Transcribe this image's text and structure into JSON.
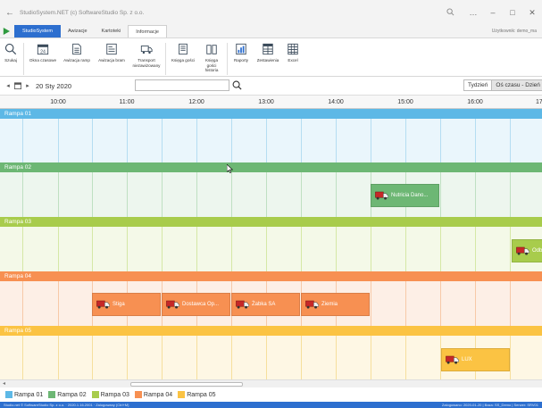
{
  "window": {
    "title": "StudioSystem.NET (c) SoftwareStudio Sp. z o.o.",
    "controls": [
      "…",
      "–",
      "□",
      "✕"
    ]
  },
  "ribbon_tabs": [
    {
      "label": "StudioSystem"
    },
    {
      "label": "Awizacje"
    },
    {
      "label": "Kartoteki"
    },
    {
      "label": "Informacje"
    }
  ],
  "user_label": "Użytkownik: demo_ma",
  "toolbar": [
    {
      "label": "Szukaj",
      "icon": "search-icon"
    },
    {
      "label": "Okna czasowe",
      "icon": "calendar-icon"
    },
    {
      "label": "Awizacja ramp",
      "icon": "document-icon"
    },
    {
      "label": "Awizacja bram",
      "icon": "gate-document-icon"
    },
    {
      "label": "Transport niezawizowany",
      "icon": "truck-icon"
    },
    {
      "label": "Księga gości",
      "icon": "book-icon"
    },
    {
      "label": "Księga gości historia",
      "icon": "book-open-icon"
    },
    {
      "label": "Raporty",
      "icon": "report-chart-icon"
    },
    {
      "label": "Zestawienia",
      "icon": "summary-table-icon"
    },
    {
      "label": "Excel",
      "icon": "excel-icon"
    }
  ],
  "datebar": {
    "date": "20 Sty 2020",
    "search_value": "",
    "view_week": "Tydzień",
    "view_axis": "Oś czasu - Dzień"
  },
  "times": [
    "10:00",
    "11:00",
    "12:00",
    "13:00",
    "14:00",
    "15:00",
    "16:00",
    "17"
  ],
  "ramps": [
    {
      "name": "Rampa 01",
      "color": "#5db8e6",
      "bg": "#eaf6fc",
      "line": "#b5ddf2"
    },
    {
      "name": "Rampa 02",
      "color": "#6db774",
      "bg": "#edf6ee",
      "line": "#bfe0c2"
    },
    {
      "name": "Rampa 03",
      "color": "#a8cc4c",
      "bg": "#f4f9e8",
      "line": "#d5e8a6"
    },
    {
      "name": "Rampa 04",
      "color": "#f79052",
      "bg": "#fdefe6",
      "line": "#f7c9a8"
    },
    {
      "name": "Rampa 05",
      "color": "#fbc343",
      "bg": "#fef7e4",
      "line": "#f6df9d"
    }
  ],
  "bookings": [
    {
      "ramp": 1,
      "label": "Nutricia Dano...",
      "color": "#6db774"
    },
    {
      "ramp": 2,
      "label": "Odb",
      "color": "#a8cc4c"
    },
    {
      "ramp": 3,
      "label": "Stiga",
      "color": "#f79052"
    },
    {
      "ramp": 3,
      "label": "Dostawca Op...",
      "color": "#f79052"
    },
    {
      "ramp": 3,
      "label": "Żabka SA",
      "color": "#f79052"
    },
    {
      "ramp": 3,
      "label": "Ziemia",
      "color": "#f79052"
    },
    {
      "ramp": 4,
      "label": "LUX",
      "color": "#fbc343"
    }
  ],
  "statusbar": {
    "left": "Studio.net © SoftwareStudio Sp. z o.o. · 2020.1.16.2001 · Zalogowany (Ctrl+M)",
    "right": "Zalogowano: 2020-01-20 | Baza: SS_Demo | Serwer: SRV01"
  }
}
